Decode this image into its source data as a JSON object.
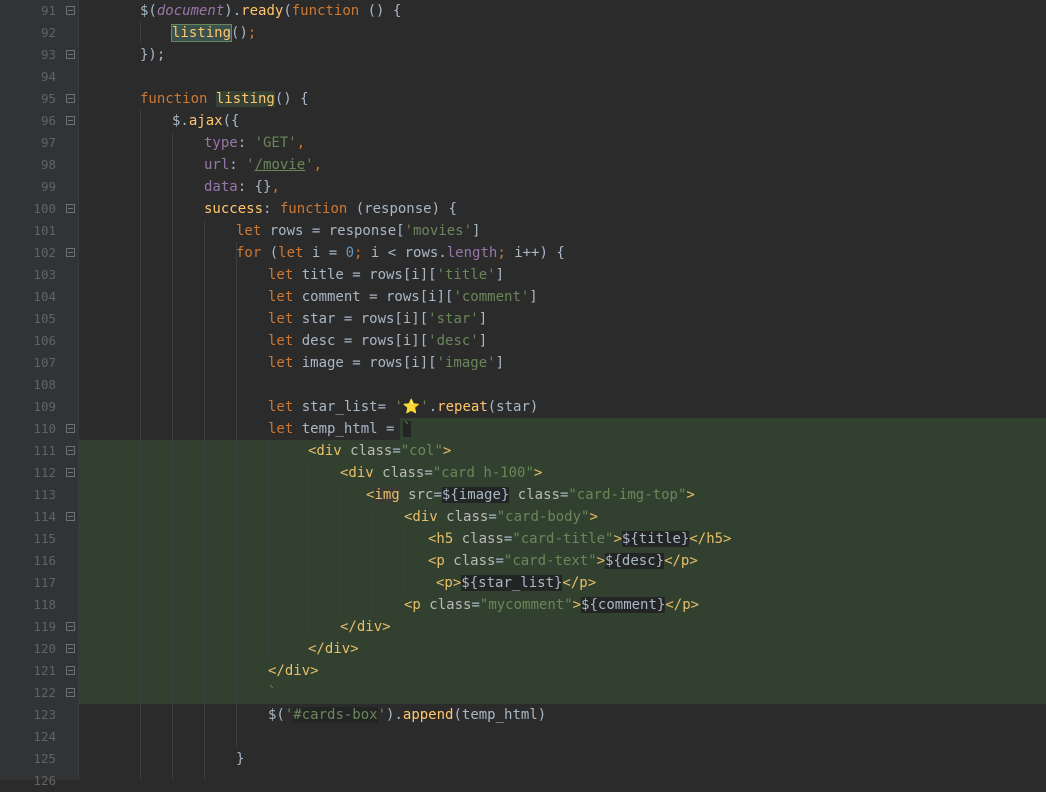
{
  "editor": {
    "lines": [
      {
        "n": "91",
        "seg": [
          [
            "pl",
            "$("
          ],
          [
            "prop ital",
            "document"
          ],
          [
            "pl",
            ")."
          ],
          [
            "fn",
            "ready"
          ],
          [
            "pl",
            "("
          ],
          [
            "kw",
            "function"
          ],
          [
            "pl",
            " () {"
          ]
        ]
      },
      {
        "n": "92",
        "seg": [
          [
            "fn ident-focus",
            "listing"
          ],
          [
            "pl",
            "()"
          ],
          [
            "kw",
            ";"
          ]
        ]
      },
      {
        "n": "93",
        "seg": [
          [
            "pl",
            "});"
          ]
        ]
      },
      {
        "n": "94",
        "seg": []
      },
      {
        "n": "95",
        "seg": [
          [
            "kw",
            "function "
          ],
          [
            "fn ident-hl",
            "listing"
          ],
          [
            "pl",
            "() {"
          ]
        ]
      },
      {
        "n": "96",
        "seg": [
          [
            "pl",
            "$."
          ],
          [
            "fn",
            "ajax"
          ],
          [
            "pl",
            "({"
          ]
        ]
      },
      {
        "n": "97",
        "seg": [
          [
            "prop",
            "type"
          ],
          [
            "pl",
            ": "
          ],
          [
            "str",
            "'GET'"
          ],
          [
            "kw",
            ","
          ]
        ]
      },
      {
        "n": "98",
        "seg": [
          [
            "prop",
            "url"
          ],
          [
            "pl",
            ": "
          ],
          [
            "str",
            "'"
          ],
          [
            "str url",
            "/movie"
          ],
          [
            "str",
            "'"
          ],
          [
            "kw",
            ","
          ]
        ]
      },
      {
        "n": "99",
        "seg": [
          [
            "prop",
            "data"
          ],
          [
            "pl",
            ": {}"
          ],
          [
            "kw",
            ","
          ]
        ]
      },
      {
        "n": "100",
        "seg": [
          [
            "fn",
            "success"
          ],
          [
            "pl",
            ": "
          ],
          [
            "kw",
            "function "
          ],
          [
            "pl",
            "(response) {"
          ]
        ]
      },
      {
        "n": "101",
        "seg": [
          [
            "kw",
            "let "
          ],
          [
            "pl",
            "rows = response["
          ],
          [
            "str",
            "'movies'"
          ],
          [
            "pl",
            "]"
          ]
        ]
      },
      {
        "n": "102",
        "seg": [
          [
            "kw",
            "for "
          ],
          [
            "pl",
            "("
          ],
          [
            "kw",
            "let "
          ],
          [
            "pl",
            "i = "
          ],
          [
            "num",
            "0"
          ],
          [
            "kw",
            "; "
          ],
          [
            "pl",
            "i < rows."
          ],
          [
            "prop",
            "length"
          ],
          [
            "kw",
            "; "
          ],
          [
            "pl",
            "i++) {"
          ]
        ]
      },
      {
        "n": "103",
        "seg": [
          [
            "kw",
            "let "
          ],
          [
            "pl",
            "title = rows[i]["
          ],
          [
            "str",
            "'title'"
          ],
          [
            "pl",
            "]"
          ]
        ]
      },
      {
        "n": "104",
        "seg": [
          [
            "kw",
            "let "
          ],
          [
            "pl",
            "comment = rows[i]["
          ],
          [
            "str",
            "'comment'"
          ],
          [
            "pl",
            "]"
          ]
        ]
      },
      {
        "n": "105",
        "seg": [
          [
            "kw",
            "let "
          ],
          [
            "pl",
            "star = rows[i]["
          ],
          [
            "str",
            "'star'"
          ],
          [
            "pl",
            "]"
          ]
        ]
      },
      {
        "n": "106",
        "seg": [
          [
            "kw",
            "let "
          ],
          [
            "pl",
            "desc = rows[i]["
          ],
          [
            "str",
            "'desc'"
          ],
          [
            "pl",
            "]"
          ]
        ]
      },
      {
        "n": "107",
        "seg": [
          [
            "kw",
            "let "
          ],
          [
            "pl",
            "image = rows[i]["
          ],
          [
            "str",
            "'image'"
          ],
          [
            "pl",
            "]"
          ]
        ]
      },
      {
        "n": "108",
        "seg": []
      },
      {
        "n": "109",
        "seg": [
          [
            "kw",
            "let "
          ],
          [
            "pl",
            "star_list= "
          ],
          [
            "str",
            "'⭐'"
          ],
          [
            "pl",
            "."
          ],
          [
            "fn",
            "repeat"
          ],
          [
            "pl",
            "(star)"
          ]
        ]
      },
      {
        "n": "110",
        "seg": [
          [
            "kw",
            "let "
          ],
          [
            "pl",
            "temp_html = "
          ],
          [
            "str tmpl",
            "`"
          ]
        ]
      },
      {
        "n": "111",
        "seg": [
          [
            "tag",
            "<div "
          ],
          [
            "attr",
            "class"
          ],
          [
            "pl",
            "="
          ],
          [
            "str",
            "\"col\""
          ],
          [
            "tag",
            ">"
          ]
        ]
      },
      {
        "n": "112",
        "seg": [
          [
            "tag",
            "<div "
          ],
          [
            "attr",
            "class"
          ],
          [
            "pl",
            "="
          ],
          [
            "str",
            "\"card h-100\""
          ],
          [
            "tag",
            ">"
          ]
        ]
      },
      {
        "n": "113",
        "seg": [
          [
            "tag",
            "<"
          ],
          [
            "tag mark-tag",
            "img"
          ],
          [
            "tag",
            " "
          ],
          [
            "attr",
            "src"
          ],
          [
            "pl",
            "="
          ],
          [
            "pl tmpl",
            "${image}"
          ],
          [
            "tag",
            " "
          ],
          [
            "attr",
            "class"
          ],
          [
            "pl",
            "="
          ],
          [
            "str",
            "\"card-img-top\""
          ],
          [
            "tag",
            ">"
          ]
        ]
      },
      {
        "n": "114",
        "seg": [
          [
            "tag",
            "<div "
          ],
          [
            "attr",
            "class"
          ],
          [
            "pl",
            "="
          ],
          [
            "str",
            "\"card-body\""
          ],
          [
            "tag",
            ">"
          ]
        ]
      },
      {
        "n": "115",
        "seg": [
          [
            "tag",
            "<h5 "
          ],
          [
            "attr",
            "class"
          ],
          [
            "pl",
            "="
          ],
          [
            "str",
            "\"card-title\""
          ],
          [
            "tag",
            ">"
          ],
          [
            "pl tmpl",
            "${title}"
          ],
          [
            "tag",
            "</h5>"
          ]
        ]
      },
      {
        "n": "116",
        "seg": [
          [
            "tag",
            "<p "
          ],
          [
            "attr",
            "class"
          ],
          [
            "pl",
            "="
          ],
          [
            "str",
            "\"card-text\""
          ],
          [
            "tag",
            ">"
          ],
          [
            "pl tmpl",
            "${desc}"
          ],
          [
            "tag",
            "</p>"
          ]
        ]
      },
      {
        "n": "117",
        "seg": [
          [
            "tag",
            "<p>"
          ],
          [
            "pl tmpl",
            "${star_list}"
          ],
          [
            "tag",
            "</p>"
          ]
        ]
      },
      {
        "n": "118",
        "seg": [
          [
            "tag",
            "<p "
          ],
          [
            "attr",
            "class"
          ],
          [
            "pl",
            "="
          ],
          [
            "str",
            "\"mycomment\""
          ],
          [
            "tag",
            ">"
          ],
          [
            "pl tmpl",
            "${comment}"
          ],
          [
            "tag",
            "</p>"
          ]
        ]
      },
      {
        "n": "119",
        "seg": [
          [
            "tag",
            "</div>"
          ]
        ]
      },
      {
        "n": "120",
        "seg": [
          [
            "tag",
            "</div>"
          ]
        ]
      },
      {
        "n": "121",
        "seg": [
          [
            "tag",
            "</div>"
          ]
        ]
      },
      {
        "n": "122",
        "seg": [
          [
            "str",
            "`"
          ]
        ]
      },
      {
        "n": "123",
        "seg": [
          [
            "pl",
            "$("
          ],
          [
            "str",
            "'"
          ],
          [
            "str tmpl",
            "#cards-box"
          ],
          [
            "str",
            "'"
          ],
          [
            "pl",
            ")."
          ],
          [
            "fn",
            "append"
          ],
          [
            "pl",
            "(temp_html)"
          ]
        ]
      },
      {
        "n": "124",
        "seg": []
      },
      {
        "n": "125",
        "seg": [
          [
            "pl",
            "}"
          ]
        ]
      },
      {
        "n": "126",
        "seg": []
      }
    ]
  }
}
